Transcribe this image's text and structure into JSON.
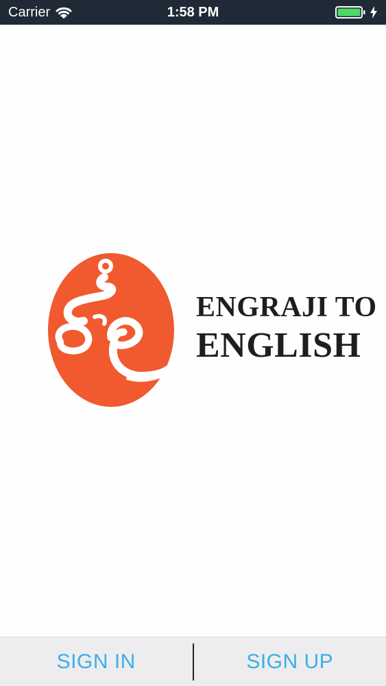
{
  "status_bar": {
    "carrier": "Carrier",
    "time": "1:58 PM",
    "wifi_icon": "wifi-icon",
    "battery_icon": "battery-icon",
    "charging_icon": "charging-bolt-icon",
    "battery_color": "#4cd964"
  },
  "brand": {
    "line1": "ENGRAJI TO",
    "line2": "ENGLISH",
    "logo_icon": "engraji-logo-icon",
    "logo_color": "#f05a2e"
  },
  "bottom_bar": {
    "sign_in_label": "SIGN IN",
    "sign_up_label": "SIGN UP",
    "button_color": "#3baee8"
  }
}
